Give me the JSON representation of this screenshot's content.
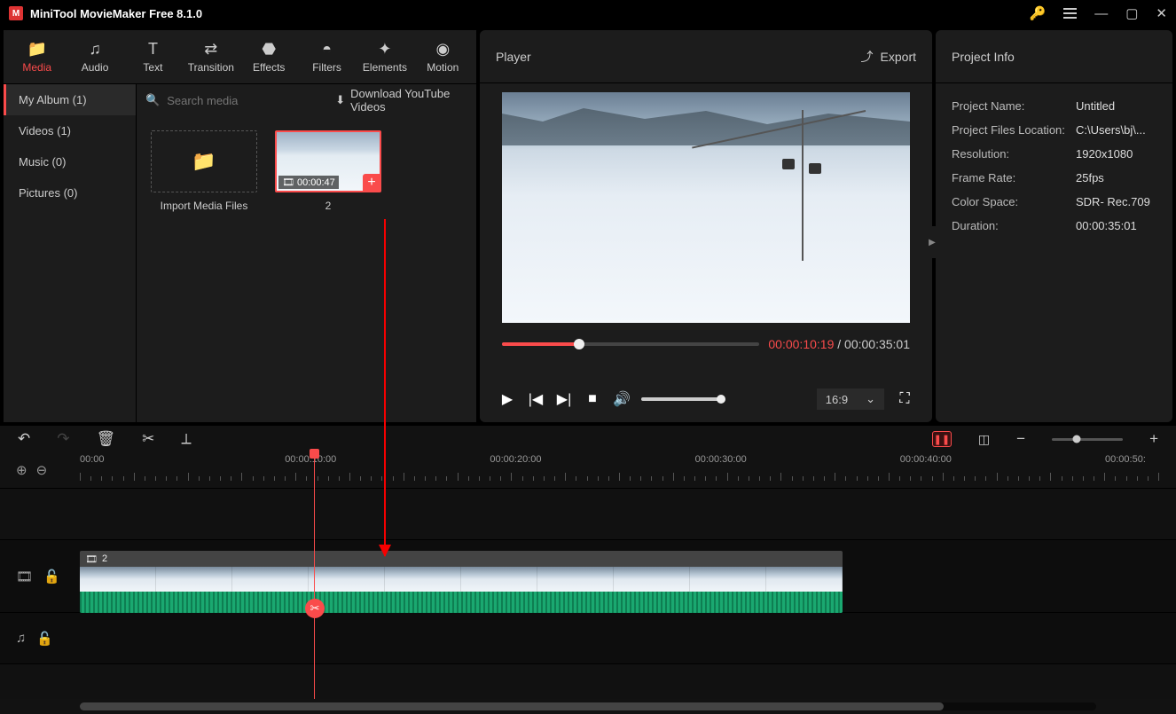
{
  "app": {
    "title": "MiniTool MovieMaker Free 8.1.0"
  },
  "tabs": [
    {
      "label": "Media"
    },
    {
      "label": "Audio"
    },
    {
      "label": "Text"
    },
    {
      "label": "Transition"
    },
    {
      "label": "Effects"
    },
    {
      "label": "Filters"
    },
    {
      "label": "Elements"
    },
    {
      "label": "Motion"
    }
  ],
  "sidebar": {
    "items": [
      {
        "label": "My Album (1)"
      },
      {
        "label": "Videos (1)"
      },
      {
        "label": "Music (0)"
      },
      {
        "label": "Pictures (0)"
      }
    ]
  },
  "media": {
    "search_placeholder": "Search media",
    "download_label": "Download YouTube Videos",
    "import_label": "Import Media Files",
    "clip": {
      "duration": "00:00:47",
      "name": "2"
    }
  },
  "player": {
    "title": "Player",
    "export_label": "Export",
    "current_time": "00:00:10:19",
    "total_time": "00:00:35:01",
    "aspect": "16:9",
    "progress_pct": 30
  },
  "project": {
    "title": "Project Info",
    "rows": {
      "name_label": "Project Name:",
      "name_value": "Untitled",
      "loc_label": "Project Files Location:",
      "loc_value": "C:\\Users\\bj\\...",
      "res_label": "Resolution:",
      "res_value": "1920x1080",
      "fps_label": "Frame Rate:",
      "fps_value": "25fps",
      "color_label": "Color Space:",
      "color_value": "SDR- Rec.709",
      "dur_label": "Duration:",
      "dur_value": "00:00:35:01"
    }
  },
  "timeline": {
    "ruler": [
      "00:00",
      "00:00:10:00",
      "00:00:20:00",
      "00:00:30:00",
      "00:00:40:00",
      "00:00:50:"
    ],
    "clip_count": "2",
    "playhead_pct": 21.5,
    "clip_width_pct": 70,
    "scroll_thumb_pct": 85
  }
}
